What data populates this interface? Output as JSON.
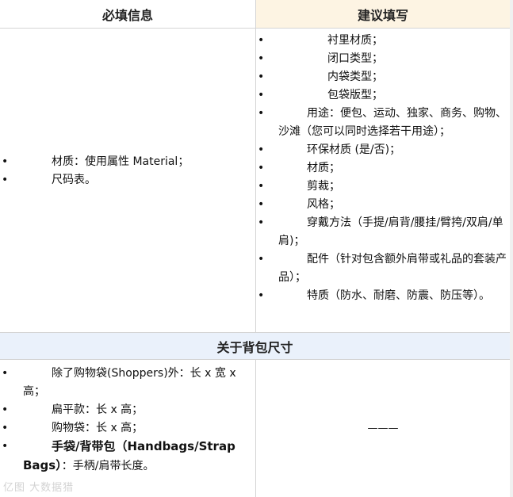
{
  "header": {
    "required_title": "必填信息",
    "suggested_title": "建议填写"
  },
  "required": {
    "items": [
      "材质：使用属性 Material；",
      "尺码表。"
    ]
  },
  "suggested": {
    "items": [
      "衬里材质；",
      "闭口类型；",
      "内袋类型；",
      "包袋版型；",
      "用途：便包、运动、独家、商务、购物、沙滩（您可以同时选择若干用途）；",
      "环保材质 (是/否)；",
      "材质；",
      "剪裁；",
      "风格；",
      "穿戴方法（手提/肩背/腰挂/臂挎/双肩/单肩)；",
      "配件（针对包含额外肩带或礼品的套装产品）；",
      "特质（防水、耐磨、防震、防压等）。"
    ]
  },
  "size_section": {
    "title": "关于背包尺寸",
    "items": [
      {
        "text": "除了购物袋(Shoppers)外：长 x 宽 x 高；"
      },
      {
        "text": "扁平款：长 x 高；"
      },
      {
        "text": "购物袋：长 x 高；"
      },
      {
        "bold": "手袋/背带包（Handbags/Strap Bags）",
        "text": "：手柄/肩带长度。"
      }
    ],
    "right_value": "———"
  },
  "watermark": "亿图 大数据猎"
}
